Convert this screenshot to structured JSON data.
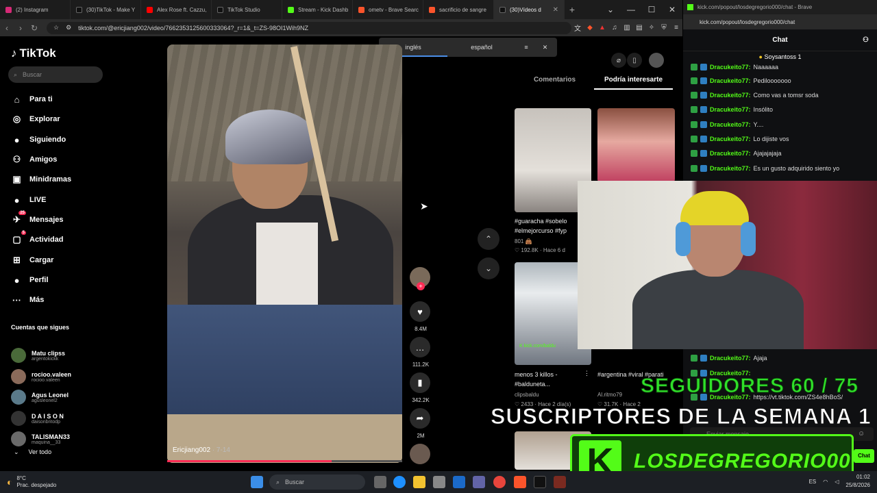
{
  "browser": {
    "tabs": [
      {
        "label": "(2) Instagram",
        "color": "#d62976"
      },
      {
        "label": "(30)TikTok - Make Y",
        "color": "#111111"
      },
      {
        "label": "Alex Rose ft. Cazzu,",
        "color": "#ff0000"
      },
      {
        "label": "TikTok Studio",
        "color": "#111111"
      },
      {
        "label": "Stream - Kick Dashb",
        "color": "#53fc18"
      },
      {
        "label": "ometv - Brave Searc",
        "color": "#fb542b"
      },
      {
        "label": "sacrificio de sangre",
        "color": "#fb542b"
      },
      {
        "label": "(30)Vídeos d",
        "color": "#111111",
        "active": true
      }
    ],
    "url": "tiktok.com/@ericjiang002/video/7662353125600333064?_r=1&_t=ZS-98OI1Wih9NZ",
    "translate": {
      "from": "inglés",
      "to": "español"
    }
  },
  "tiktok": {
    "logo": "TikTok",
    "search_placeholder": "Buscar",
    "nav": [
      {
        "label": "Para ti",
        "icon": "home-icon",
        "glyph": "⌂"
      },
      {
        "label": "Explorar",
        "icon": "compass-icon",
        "glyph": "◎"
      },
      {
        "label": "Siguiendo",
        "icon": "following-icon",
        "glyph": "●"
      },
      {
        "label": "Amigos",
        "icon": "friends-icon",
        "glyph": "⚇"
      },
      {
        "label": "Minidramas",
        "icon": "minidramas-icon",
        "glyph": "▣"
      },
      {
        "label": "LIVE",
        "icon": "live-icon",
        "glyph": "●"
      },
      {
        "label": "Mensajes",
        "icon": "messages-icon",
        "glyph": "✈",
        "badge": "25"
      },
      {
        "label": "Actividad",
        "icon": "activity-icon",
        "glyph": "▢",
        "badge": "5"
      },
      {
        "label": "Cargar",
        "icon": "upload-icon",
        "glyph": "⊞"
      },
      {
        "label": "Perfil",
        "icon": "profile-icon",
        "glyph": "●"
      },
      {
        "label": "Más",
        "icon": "more-icon",
        "glyph": "···"
      }
    ],
    "following_title": "Cuentas que sigues",
    "following": [
      {
        "name": "Matu clipss",
        "handle": "argentokickk"
      },
      {
        "name": "rocioo.valeen",
        "handle": "rocioo.valeen"
      },
      {
        "name": "Agus Leonel",
        "handle": "agusleonel2"
      },
      {
        "name": "D A I S O N",
        "handle": "daisonbritodp"
      },
      {
        "name": "TALISMAN33",
        "handle": "maquina__33"
      }
    ],
    "see_all": "Ver todo",
    "video": {
      "author": "Ericjiang002",
      "time": "· 7-14",
      "progress": 0.7
    },
    "actions": [
      {
        "name": "like",
        "glyph": "♥",
        "count": "8.4M"
      },
      {
        "name": "comment",
        "glyph": "…",
        "count": "111.2K"
      },
      {
        "name": "save",
        "glyph": "▮",
        "count": "342.2K"
      },
      {
        "name": "share",
        "glyph": "➦",
        "count": "2M"
      }
    ],
    "panel_tabs": [
      "Comentarios",
      "Podría interesarte"
    ],
    "recs": [
      {
        "caption": "#guaracha #sobelo #elmejorcurso #fyp",
        "meta": "192.8K · Hace 6 d",
        "count2": "801"
      },
      {
        "caption": "",
        "meta": ""
      },
      {
        "caption": "menos 3 killos - #balduneta...",
        "author": "clipsbaldu",
        "meta": "2433 · Hace 2 día(s)"
      },
      {
        "caption": "#argentina #viral #parati",
        "author": "Al.ritmo79",
        "meta": "31.7K · Hace 2"
      }
    ]
  },
  "kick": {
    "tab_title": "kick.com/popout/losdegregorio000/chat - Brave",
    "url": "kick.com/popout/losdegregorio000/chat",
    "header": "Chat",
    "pinned": "Soysantoss 1",
    "messages": [
      {
        "user": "Dracukeito77:",
        "text": "Naaaaaa"
      },
      {
        "user": "Dracukeito77:",
        "text": "Pedilooooooo"
      },
      {
        "user": "Dracukeito77:",
        "text": "Como vas a tomsr soda"
      },
      {
        "user": "Dracukeito77:",
        "text": "Insólito"
      },
      {
        "user": "Dracukeito77:",
        "text": "Y...."
      },
      {
        "user": "Dracukeito77:",
        "text": "Lo dijiste vos"
      },
      {
        "user": "Dracukeito77:",
        "text": "Ajajajajaja"
      },
      {
        "user": "Dracukeito77:",
        "text": "Es un gusto adquirido siento yo"
      },
      {
        "user": "Dracukeito77:",
        "text": "Ajaja"
      },
      {
        "user": "Dracukeito77:",
        "text": ""
      },
      {
        "user": "Dracukeito77:",
        "text": "https://vt.tiktok.com/ZS4e8hBoS/"
      }
    ],
    "chat_placeholder": "Enviar mensaje",
    "chat_button": "Chat"
  },
  "overlay": {
    "followers": "SEGUIDORES 60 / 75",
    "subs": "SUSCRIPTORES DE LA SEMANA 1",
    "channel": "LOSDEGREGORIO00",
    "k_logo": "K"
  },
  "taskbar": {
    "weather_temp": "8°C",
    "weather_desc": "Prac. despejado",
    "search": "Buscar",
    "lang": "ES",
    "time": "01:02",
    "date": "25/8/2026"
  }
}
